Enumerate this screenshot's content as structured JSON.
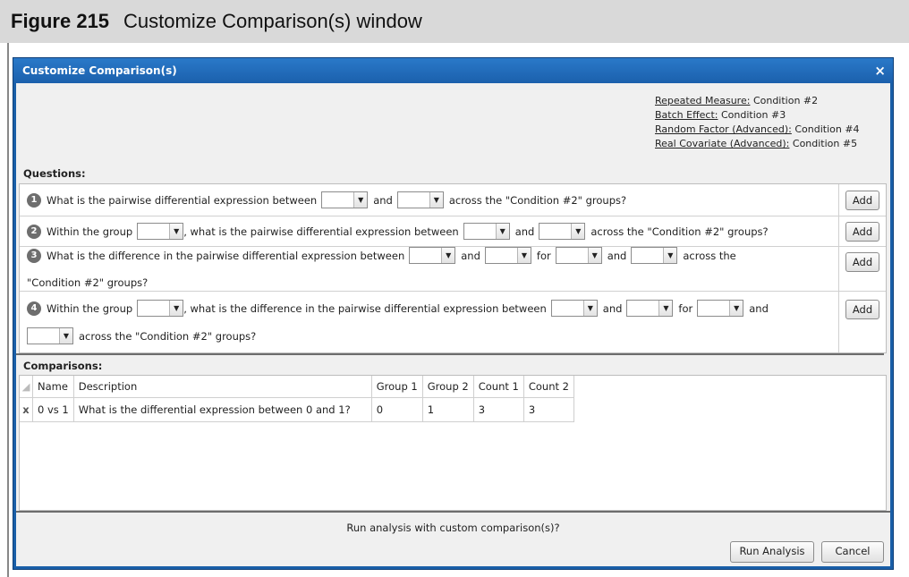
{
  "caption": {
    "figure_label": "Figure 215",
    "title": "Customize Comparison(s) window"
  },
  "window": {
    "title": "Customize Comparison(s)",
    "close_glyph": "×"
  },
  "factors": [
    {
      "key": "Repeated Measure:",
      "value": "Condition #2"
    },
    {
      "key": "Batch Effect:",
      "value": "Condition #3"
    },
    {
      "key": "Random Factor (Advanced):",
      "value": "Condition #4"
    },
    {
      "key": "Real Covariate (Advanced):",
      "value": "Condition #5"
    }
  ],
  "questions_label": "Questions:",
  "questions": [
    {
      "number": "1",
      "parts": [
        "What is the pairwise differential expression between",
        "and",
        "across the \"Condition #2\" groups?"
      ],
      "add_label": "Add"
    },
    {
      "number": "2",
      "parts": [
        "Within the group",
        ", what is the pairwise differential expression between",
        "and",
        "across the \"Condition #2\" groups?"
      ],
      "add_label": "Add"
    },
    {
      "number": "3",
      "parts": [
        "What is the difference in the pairwise differential expression between",
        "and",
        "for",
        "and",
        "across the",
        "\"Condition #2\" groups?"
      ],
      "add_label": "Add"
    },
    {
      "number": "4",
      "parts": [
        "Within the group",
        ", what is the difference in the pairwise differential expression between",
        "and",
        "for",
        "and",
        "across the \"Condition #2\" groups?"
      ],
      "add_label": "Add"
    }
  ],
  "comparisons_label": "Comparisons:",
  "table": {
    "columns": [
      "Name",
      "Description",
      "Group 1",
      "Group 2",
      "Count 1",
      "Count 2"
    ],
    "rows": [
      {
        "remove_glyph": "x",
        "cells": [
          "0 vs 1",
          "What is the differential expression between 0 and 1?",
          "0",
          "1",
          "3",
          "3"
        ]
      }
    ]
  },
  "footer": {
    "prompt": "Run analysis with custom comparison(s)?",
    "run_label": "Run Analysis",
    "cancel_label": "Cancel"
  },
  "icons": {
    "dropdown_arrow": "dropdown-arrow-icon",
    "close": "close-icon"
  },
  "colors": {
    "title_bar": "#1b60ac",
    "caption_bar": "#d9d9d9",
    "client": "#f0f0f0"
  }
}
